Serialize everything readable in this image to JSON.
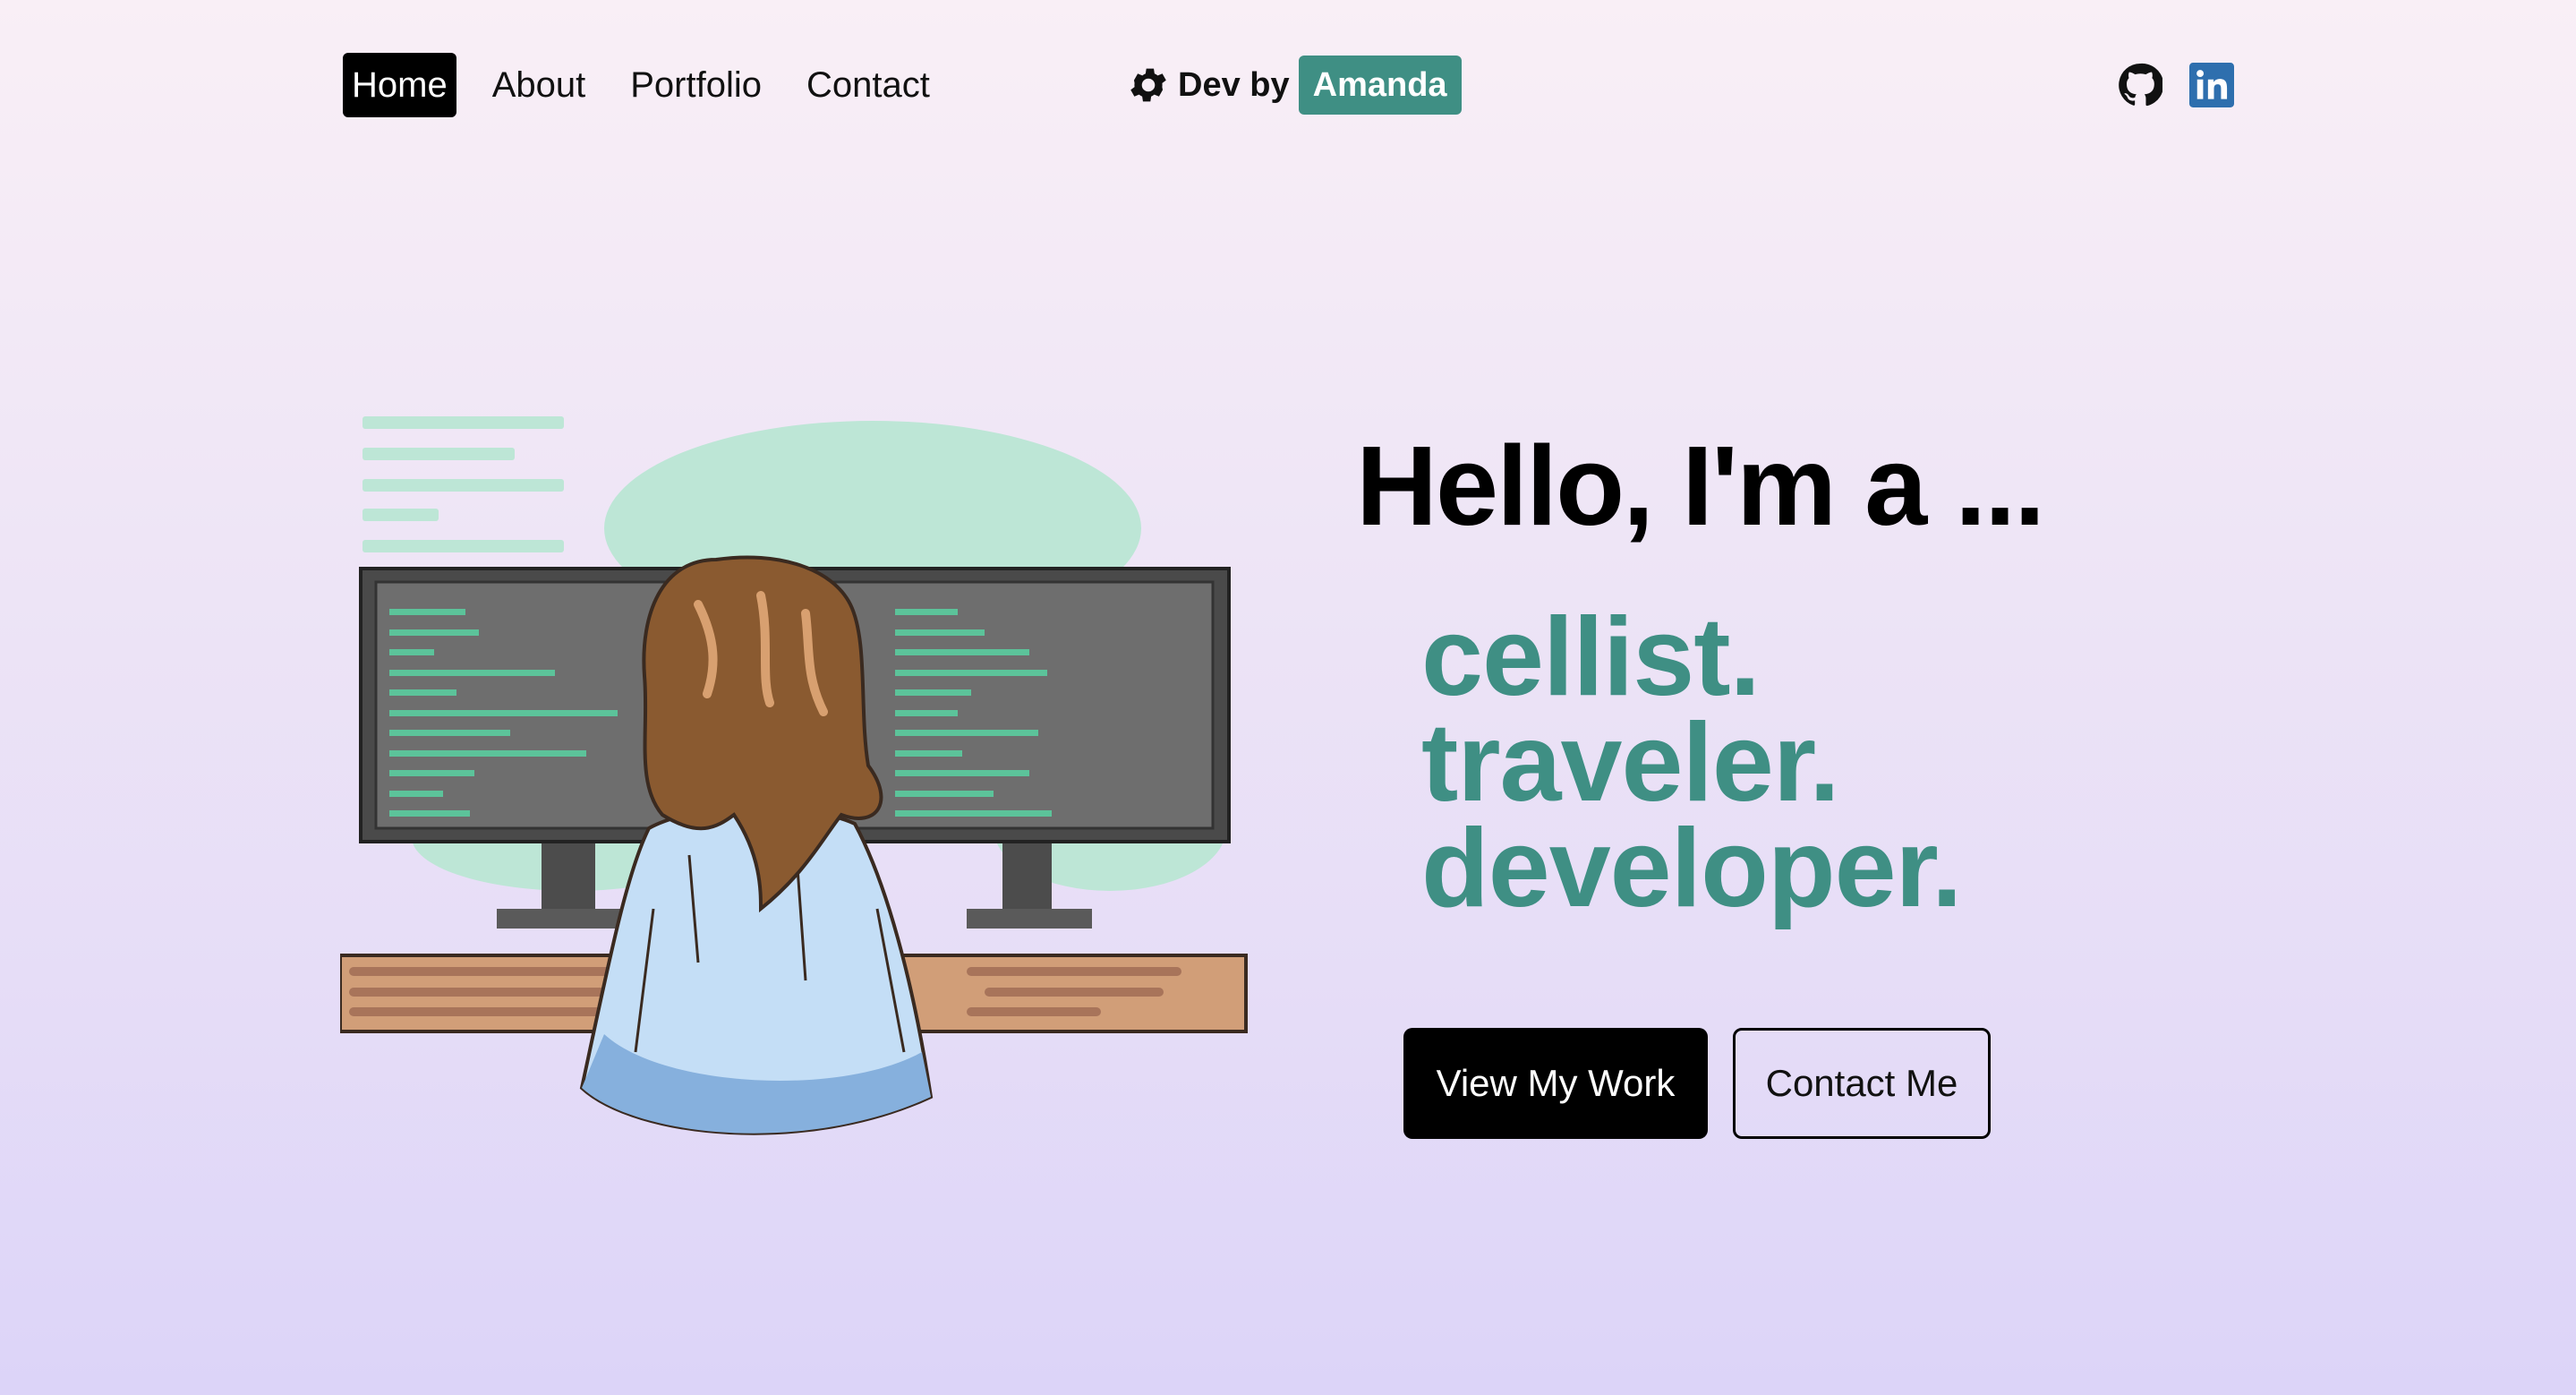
{
  "nav": {
    "links": [
      {
        "label": "Home",
        "active": true
      },
      {
        "label": "About",
        "active": false
      },
      {
        "label": "Portfolio",
        "active": false
      },
      {
        "label": "Contact",
        "active": false
      }
    ],
    "brand": {
      "icon": "gear-icon",
      "prefix": "Dev by",
      "name": "Amanda"
    },
    "social": [
      "github-icon",
      "linkedin-icon"
    ]
  },
  "hero": {
    "heading": "Hello, I'm a ...",
    "roles": [
      "cellist.",
      "traveler.",
      "developer."
    ],
    "primary_button": "View My Work",
    "secondary_button": "Contact Me"
  },
  "colors": {
    "accent": "#3f8f84",
    "linkedin": "#2e6fae"
  }
}
